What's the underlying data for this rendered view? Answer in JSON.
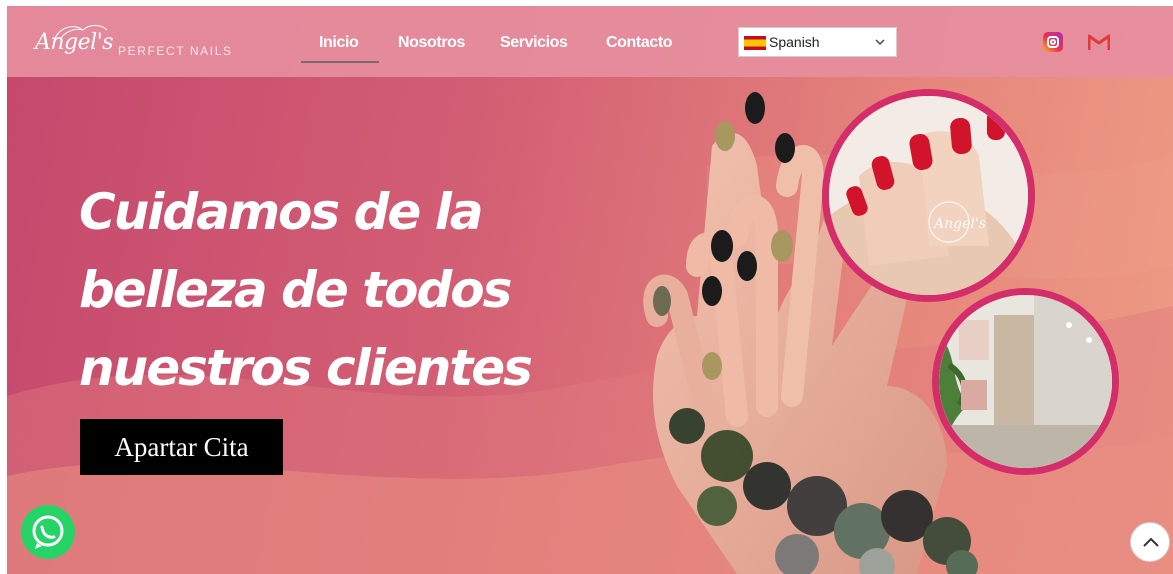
{
  "brand": {
    "logo_script": "Angel's",
    "logo_sub": "PERFECT NAILS"
  },
  "nav": {
    "items": [
      {
        "label": "Inicio",
        "active": true
      },
      {
        "label": "Nosotros",
        "active": false
      },
      {
        "label": "Servicios",
        "active": false
      },
      {
        "label": "Contacto",
        "active": false
      }
    ]
  },
  "language": {
    "selected": "Spanish",
    "flag_icon": "spain-flag-icon"
  },
  "social": {
    "instagram_icon": "instagram-icon",
    "gmail_icon": "gmail-icon"
  },
  "hero": {
    "title_lines": [
      "Cuidamos de la",
      "belleza de todos",
      "nuestros clientes"
    ],
    "cta_label": "Apartar Cita",
    "photo1_watermark": "Angel's"
  },
  "floating": {
    "whatsapp_icon": "whatsapp-icon",
    "scroll_top_icon": "chevron-up-icon"
  },
  "colors": {
    "accent": "#d42e6a",
    "header_bg": "#e68e9e",
    "hero_start": "#c5486d",
    "hero_end": "#ee9c85",
    "cta_bg": "#000000",
    "whatsapp": "#25d366"
  }
}
